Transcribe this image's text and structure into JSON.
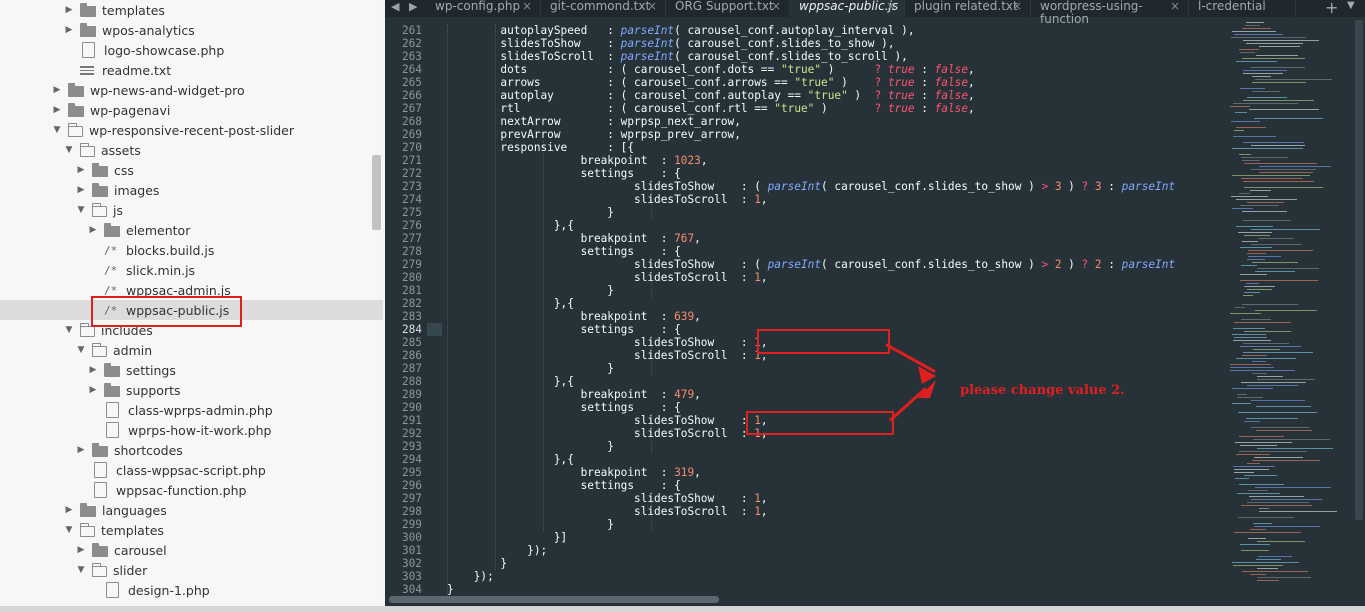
{
  "sidebar": {
    "items": [
      {
        "label": "templates",
        "type": "folder",
        "expanded": false,
        "indent": 1
      },
      {
        "label": "wpos-analytics",
        "type": "folder",
        "expanded": false,
        "indent": 1
      },
      {
        "label": "logo-showcase.php",
        "type": "file",
        "icon": "doc-icon",
        "indent": 1
      },
      {
        "label": "readme.txt",
        "type": "file",
        "icon": "text-icon",
        "indent": 1
      },
      {
        "label": "wp-news-and-widget-pro",
        "type": "folder",
        "expanded": false,
        "indent": 0
      },
      {
        "label": "wp-pagenavi",
        "type": "folder",
        "expanded": false,
        "indent": 0
      },
      {
        "label": "wp-responsive-recent-post-slider",
        "type": "folder",
        "expanded": true,
        "indent": 0
      },
      {
        "label": "assets",
        "type": "folder",
        "expanded": true,
        "indent": 1
      },
      {
        "label": "css",
        "type": "folder",
        "expanded": false,
        "indent": 2
      },
      {
        "label": "images",
        "type": "folder",
        "expanded": false,
        "indent": 2
      },
      {
        "label": "js",
        "type": "folder",
        "expanded": true,
        "indent": 2
      },
      {
        "label": "elementor",
        "type": "folder",
        "expanded": false,
        "indent": 3
      },
      {
        "label": "blocks.build.js",
        "type": "file",
        "icon": "js-icon",
        "indent": 3
      },
      {
        "label": "slick.min.js",
        "type": "file",
        "icon": "js-icon",
        "indent": 3
      },
      {
        "label": "wppsac-admin.js",
        "type": "file",
        "icon": "js-icon",
        "indent": 3
      },
      {
        "label": "wppsac-public.js",
        "type": "file",
        "icon": "js-icon",
        "indent": 3,
        "selected": true
      },
      {
        "label": "includes",
        "type": "folder",
        "expanded": true,
        "indent": 1
      },
      {
        "label": "admin",
        "type": "folder",
        "expanded": true,
        "indent": 2
      },
      {
        "label": "settings",
        "type": "folder",
        "expanded": false,
        "indent": 3
      },
      {
        "label": "supports",
        "type": "folder",
        "expanded": false,
        "indent": 3
      },
      {
        "label": "class-wprps-admin.php",
        "type": "file",
        "icon": "doc-icon",
        "indent": 3
      },
      {
        "label": "wprps-how-it-work.php",
        "type": "file",
        "icon": "doc-icon",
        "indent": 3
      },
      {
        "label": "shortcodes",
        "type": "folder",
        "expanded": false,
        "indent": 2
      },
      {
        "label": "class-wppsac-script.php",
        "type": "file",
        "icon": "doc-icon",
        "indent": 2
      },
      {
        "label": "wppsac-function.php",
        "type": "file",
        "icon": "doc-icon",
        "indent": 2
      },
      {
        "label": "languages",
        "type": "folder",
        "expanded": false,
        "indent": 1
      },
      {
        "label": "templates",
        "type": "folder",
        "expanded": true,
        "indent": 1
      },
      {
        "label": "carousel",
        "type": "folder",
        "expanded": false,
        "indent": 2
      },
      {
        "label": "slider",
        "type": "folder",
        "expanded": true,
        "indent": 2
      },
      {
        "label": "design-1.php",
        "type": "file",
        "icon": "doc-icon",
        "indent": 3
      }
    ]
  },
  "tabs": [
    {
      "label": "wp-config.php",
      "active": false
    },
    {
      "label": "git-commond.txt",
      "active": false
    },
    {
      "label": "ORG Support.txt",
      "active": false
    },
    {
      "label": "wppsac-public.js",
      "active": true
    },
    {
      "label": "plugin related.txt",
      "active": false
    },
    {
      "label": "wordpress-using-function",
      "active": false
    },
    {
      "label": "l-credential",
      "active": false
    }
  ],
  "tab_close_glyph": "×",
  "tab_nav_glyph": "◀ ▶",
  "tab_add_glyph": "+",
  "tab_menu_glyph": "▼",
  "editor": {
    "current_line": 284,
    "lines": [
      {
        "n": 261,
        "t": "        autoplaySpeed   : parseInt( carousel_conf.autoplay_interval ),"
      },
      {
        "n": 262,
        "t": "        slidesToShow    : parseInt( carousel_conf.slides_to_show ),"
      },
      {
        "n": 263,
        "t": "        slidesToScroll  : parseInt( carousel_conf.slides_to_scroll ),"
      },
      {
        "n": 264,
        "t": "        dots            : ( carousel_conf.dots == \"true\" )      ? true : false,"
      },
      {
        "n": 265,
        "t": "        arrows          : ( carousel_conf.arrows == \"true\" )    ? true : false,"
      },
      {
        "n": 266,
        "t": "        autoplay        : ( carousel_conf.autoplay == \"true\" )  ? true : false,"
      },
      {
        "n": 267,
        "t": "        rtl             : ( carousel_conf.rtl == \"true\" )       ? true : false,"
      },
      {
        "n": 268,
        "t": "        nextArrow       : wprpsp_next_arrow,"
      },
      {
        "n": 269,
        "t": "        prevArrow       : wprpsp_prev_arrow,"
      },
      {
        "n": 270,
        "t": "        responsive      : [{"
      },
      {
        "n": 271,
        "t": "                    breakpoint  : 1023,"
      },
      {
        "n": 272,
        "t": "                    settings    : {"
      },
      {
        "n": 273,
        "t": "                            slidesToShow    : ( parseInt( carousel_conf.slides_to_show ) > 3 ) ? 3 : parseInt"
      },
      {
        "n": 274,
        "t": "                            slidesToScroll  : 1,"
      },
      {
        "n": 275,
        "t": "                        }"
      },
      {
        "n": 276,
        "t": "                },{"
      },
      {
        "n": 277,
        "t": "                    breakpoint  : 767,"
      },
      {
        "n": 278,
        "t": "                    settings    : {"
      },
      {
        "n": 279,
        "t": "                            slidesToShow    : ( parseInt( carousel_conf.slides_to_show ) > 2 ) ? 2 : parseInt"
      },
      {
        "n": 280,
        "t": "                            slidesToScroll  : 1,"
      },
      {
        "n": 281,
        "t": "                        }"
      },
      {
        "n": 282,
        "t": "                },{"
      },
      {
        "n": 283,
        "t": "                    breakpoint  : 639,"
      },
      {
        "n": 284,
        "t": "                    settings    : {"
      },
      {
        "n": 285,
        "t": "                            slidesToShow    : 1,"
      },
      {
        "n": 286,
        "t": "                            slidesToScroll  : 1,"
      },
      {
        "n": 287,
        "t": "                        }"
      },
      {
        "n": 288,
        "t": "                },{"
      },
      {
        "n": 289,
        "t": "                    breakpoint  : 479,"
      },
      {
        "n": 290,
        "t": "                    settings    : {"
      },
      {
        "n": 291,
        "t": "                            slidesToShow    : 1,"
      },
      {
        "n": 292,
        "t": "                            slidesToScroll  : 1,"
      },
      {
        "n": 293,
        "t": "                        }"
      },
      {
        "n": 294,
        "t": "                },{"
      },
      {
        "n": 295,
        "t": "                    breakpoint  : 319,"
      },
      {
        "n": 296,
        "t": "                    settings    : {"
      },
      {
        "n": 297,
        "t": "                            slidesToShow    : 1,"
      },
      {
        "n": 298,
        "t": "                            slidesToScroll  : 1,"
      },
      {
        "n": 299,
        "t": "                        }"
      },
      {
        "n": 300,
        "t": "                }]"
      },
      {
        "n": 301,
        "t": "            });"
      },
      {
        "n": 302,
        "t": "        }"
      },
      {
        "n": 303,
        "t": "    });"
      },
      {
        "n": 304,
        "t": "}"
      }
    ]
  },
  "annotation": {
    "note": "please change value 2.",
    "color": "#e01f1f"
  },
  "colors": {
    "editor_bg": "#263238",
    "sidebar_bg": "#f7f7f7",
    "keyword": "#89ddff",
    "function": "#82aaff",
    "number": "#f78c6c",
    "string": "#c3e88d",
    "boolean": "#ff5370"
  }
}
